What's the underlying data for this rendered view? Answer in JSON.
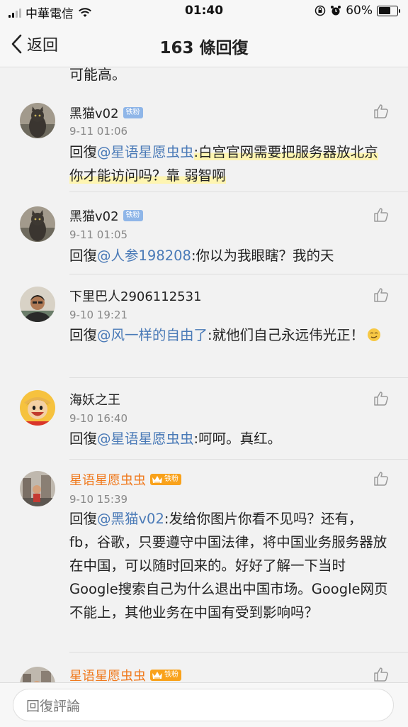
{
  "status_bar": {
    "carrier": "中華電信",
    "time": "01:40",
    "battery": "60%"
  },
  "nav": {
    "back_label": "返回",
    "title": "163 條回復"
  },
  "prev_tail": "可能高。",
  "comments": [
    {
      "user": "黑猫v02",
      "badge": "铁粉",
      "time": "9-11 01:06",
      "reply_prefix": "回復",
      "mention": "@星语星愿虫虫",
      "text": ":白宫官网需要把服务器放北京你才能访问吗？靠 弱智啊"
    },
    {
      "user": "黑猫v02",
      "badge": "铁粉",
      "time": "9-11 01:05",
      "reply_prefix": "回復",
      "mention": "@人参198208",
      "text": ":你以为我眼瞎？我的天"
    },
    {
      "user": "下里巴人2906112531",
      "time": "9-10 19:21",
      "reply_prefix": "回復",
      "mention": "@风一样的自由了",
      "text": ":就他们自己永远伟光正！"
    },
    {
      "user": "海妖之王",
      "time": "9-10 16:40",
      "reply_prefix": "回復",
      "mention": "@星语星愿虫虫",
      "text": ":呵呵。真红。"
    },
    {
      "user": "星语星愿虫虫",
      "badge": "铁粉",
      "time": "9-10 15:39",
      "reply_prefix": "回復",
      "mention": "@黑猫v02",
      "text": ":发给你图片你看不见吗？还有，fb，谷歌，只要遵守中国法律，将中国业务服务器放在中国，可以随时回来的。好好了解一下当时Google搜索自己为什么退出中国市场。Google网页不能上，其他业务在中国有受到影响吗？"
    },
    {
      "user": "星语星愿虫虫",
      "badge": "铁粉"
    }
  ],
  "reply_bar": {
    "placeholder": "回復評論"
  },
  "colors": {
    "mention": "#4a7ab7",
    "vip_name": "#f07a1e",
    "fan_badge": "#8fb6e8",
    "vip_badge": "#f9a21b"
  },
  "icons": [
    "wifi-icon",
    "rotation-lock-icon",
    "alarm-icon",
    "battery-icon",
    "chevron-left-icon",
    "thumbs-up-icon",
    "smirk-emoji-icon",
    "crown-icon"
  ]
}
